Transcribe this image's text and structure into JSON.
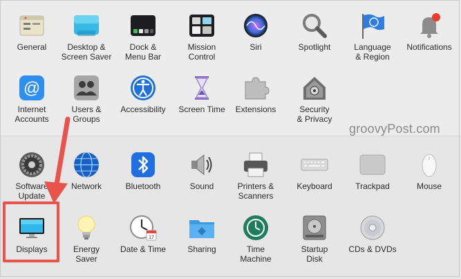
{
  "watermark": "groovyPost.com",
  "colors": {
    "highlight": "#e8534b",
    "arrow": "#e8534b"
  },
  "rows": [
    [
      {
        "name": "general",
        "label": "General",
        "icon": "general-icon"
      },
      {
        "name": "desktop-screen-saver",
        "label": "Desktop &\nScreen Saver",
        "icon": "desktop-icon"
      },
      {
        "name": "dock-menu-bar",
        "label": "Dock &\nMenu Bar",
        "icon": "dock-icon"
      },
      {
        "name": "mission-control",
        "label": "Mission\nControl",
        "icon": "mission-control-icon"
      },
      {
        "name": "siri",
        "label": "Siri",
        "icon": "siri-icon"
      },
      {
        "name": "spotlight",
        "label": "Spotlight",
        "icon": "spotlight-icon"
      },
      {
        "name": "language-region",
        "label": "Language\n& Region",
        "icon": "flag-icon"
      },
      {
        "name": "notifications",
        "label": "Notifications",
        "icon": "bell-icon"
      }
    ],
    [
      {
        "name": "internet-accounts",
        "label": "Internet\nAccounts",
        "icon": "at-icon"
      },
      {
        "name": "users-groups",
        "label": "Users &\nGroups",
        "icon": "users-icon"
      },
      {
        "name": "accessibility",
        "label": "Accessibility",
        "icon": "accessibility-icon"
      },
      {
        "name": "screen-time",
        "label": "Screen Time",
        "icon": "hourglass-icon"
      },
      {
        "name": "extensions",
        "label": "Extensions",
        "icon": "puzzle-icon"
      },
      {
        "name": "security-privacy",
        "label": "Security\n& Privacy",
        "icon": "house-lock-icon"
      }
    ],
    [
      {
        "name": "software-update",
        "label": "Software\nUpdate",
        "icon": "gear-icon"
      },
      {
        "name": "network",
        "label": "Network",
        "icon": "globe-icon"
      },
      {
        "name": "bluetooth",
        "label": "Bluetooth",
        "icon": "bluetooth-icon"
      },
      {
        "name": "sound",
        "label": "Sound",
        "icon": "speaker-icon"
      },
      {
        "name": "printers-scanners",
        "label": "Printers &\nScanners",
        "icon": "printer-icon"
      },
      {
        "name": "keyboard",
        "label": "Keyboard",
        "icon": "keyboard-icon"
      },
      {
        "name": "trackpad",
        "label": "Trackpad",
        "icon": "trackpad-icon"
      },
      {
        "name": "mouse",
        "label": "Mouse",
        "icon": "mouse-icon"
      }
    ],
    [
      {
        "name": "displays",
        "label": "Displays",
        "icon": "display-icon"
      },
      {
        "name": "energy-saver",
        "label": "Energy\nSaver",
        "icon": "lightbulb-icon"
      },
      {
        "name": "date-time",
        "label": "Date & Time",
        "icon": "clock-icon"
      },
      {
        "name": "sharing",
        "label": "Sharing",
        "icon": "folder-icon"
      },
      {
        "name": "time-machine",
        "label": "Time\nMachine",
        "icon": "time-machine-icon"
      },
      {
        "name": "startup-disk",
        "label": "Startup\nDisk",
        "icon": "disk-icon"
      },
      {
        "name": "cds-dvds",
        "label": "CDs & DVDs",
        "icon": "cd-icon"
      }
    ]
  ]
}
